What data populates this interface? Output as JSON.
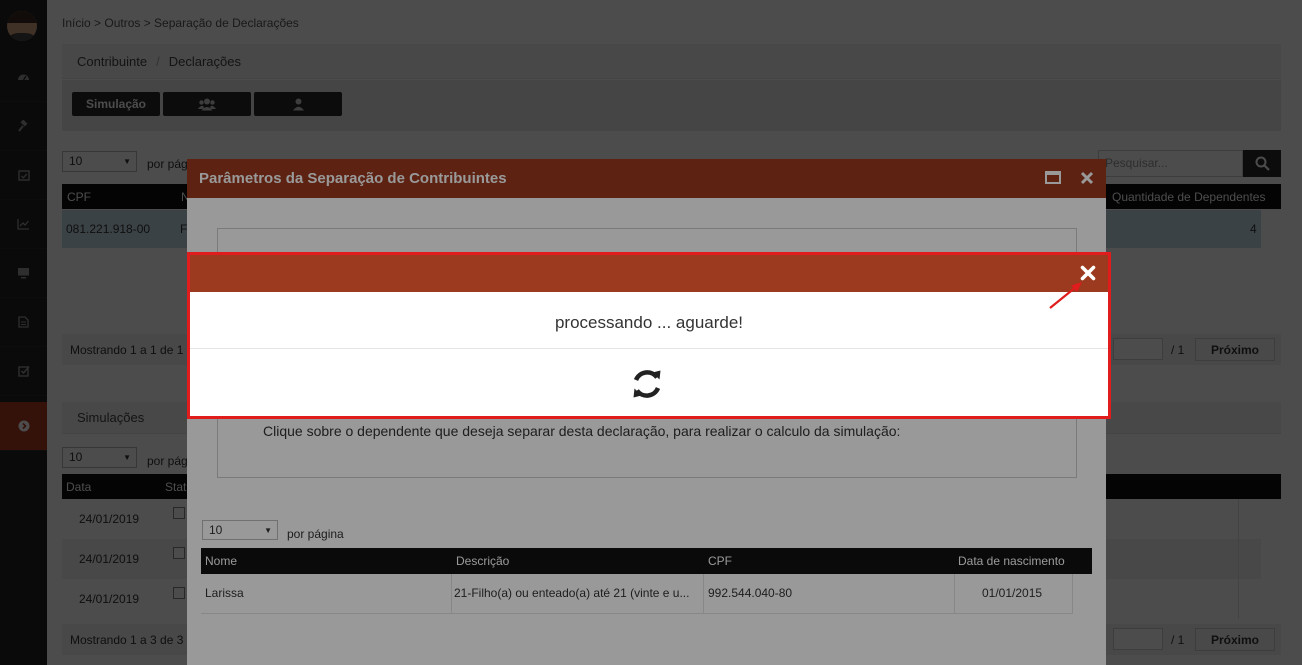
{
  "breadcrumb": "Início > Outros > Separação de Declarações",
  "tabs": {
    "contribuinte": "Contribuinte",
    "separator": "/",
    "declaracoes": "Declarações"
  },
  "toolbar": {
    "simulacao": "Simulação"
  },
  "table1": {
    "per_page_value": "10",
    "per_page_label": "por página",
    "search_placeholder": "Pesquisar...",
    "columns": {
      "cpf": "CPF",
      "col2_partial": "N",
      "dependentes": "Quantidade de Dependentes"
    },
    "rows": [
      {
        "cpf": "081.221.918-00",
        "col2_partial": "F",
        "dependentes": "4"
      }
    ],
    "footer": "Mostrando 1 a 1 de 1",
    "page_total": "/ 1",
    "next": "Próximo"
  },
  "simulacoes": {
    "title": "Simulações",
    "per_page_value": "10",
    "per_page_label": "por página",
    "columns": {
      "data": "Data",
      "status_partial": "Stat"
    },
    "rows": [
      {
        "data": "24/01/2019"
      },
      {
        "data": "24/01/2019"
      },
      {
        "data": "24/01/2019"
      }
    ],
    "footer": "Mostrando 1 a 3 de 3",
    "page_total": "/ 1",
    "next": "Próximo"
  },
  "modal_params": {
    "title": "Parâmetros da Separação de Contribuintes",
    "instruction": "Clique sobre o dependente que deseja separar desta declaração, para realizar o calculo da simulação:",
    "per_page_value": "10",
    "per_page_label": "por página",
    "columns": {
      "nome": "Nome",
      "descricao": "Descrição",
      "cpf": "CPF",
      "nascimento": "Data de nascimento"
    },
    "rows": [
      {
        "nome": "Larissa",
        "descricao": "21-Filho(a) ou enteado(a) até 21 (vinte e u...",
        "cpf": "992.544.040-80",
        "nascimento": "01/01/2015"
      }
    ]
  },
  "modal_processing": {
    "message": "processando ... aguarde!"
  },
  "icons": {
    "sidebar": [
      "dashboard-icon",
      "gavel-icon",
      "calendar-check-icon",
      "line-chart-icon",
      "desktop-icon",
      "document-icon",
      "checkbox-icon",
      "arrow-circle-right-icon"
    ],
    "toolbar": [
      "users-group-icon",
      "user-icon"
    ],
    "modal": [
      "maximize-icon",
      "close-icon",
      "refresh-icon"
    ]
  },
  "colors": {
    "header_brand": "#9b3a1e",
    "sidebar_active": "#b03a1e",
    "highlight_border": "#e01c1c",
    "selected_row": "#c6dde6"
  }
}
